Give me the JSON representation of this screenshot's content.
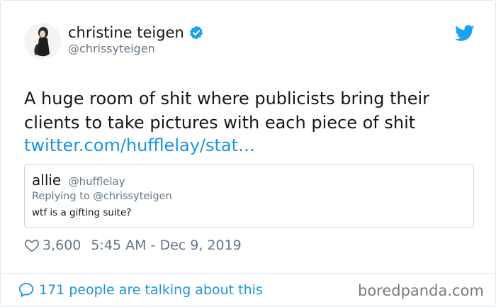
{
  "author": {
    "name": "christine teigen",
    "handle": "@chrissyteigen",
    "avatar": "avatar",
    "verified_icon": "verified-badge-icon",
    "brand_icon": "twitter-bird-icon"
  },
  "tweet": {
    "text": "A huge room of shit where publicists bring their clients to take pictures with each piece of shit",
    "link": "twitter.com/hufflelay/stat…"
  },
  "quoted_tweet": {
    "name": "allie",
    "handle": "@hufflelay",
    "reply_to": "Replying to @chrissyteigen",
    "text": "wtf is a gifting suite?"
  },
  "stats": {
    "likes": "3,600",
    "timestamp": "5:45 AM - Dec 9, 2019"
  },
  "footer": {
    "talking": "171 people are talking about this",
    "watermark": "boredpanda.com"
  },
  "colors": {
    "accent": "#1b95e0",
    "text": "#14171a",
    "muted": "#657786",
    "border": "#e1e8ed"
  }
}
